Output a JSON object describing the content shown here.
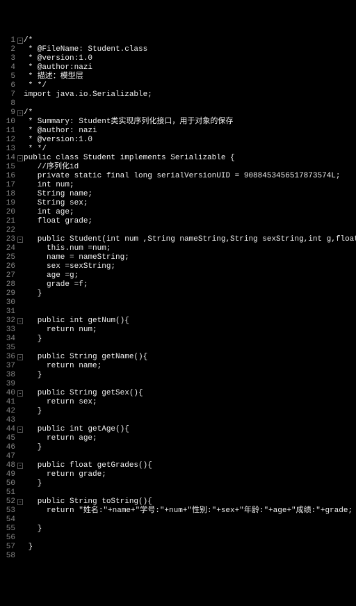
{
  "lines": [
    {
      "n": 1,
      "f": "⊟",
      "t": "/*"
    },
    {
      "n": 2,
      "f": "",
      "t": " * @FileName: Student.class"
    },
    {
      "n": 3,
      "f": "",
      "t": " * @version:1.0"
    },
    {
      "n": 4,
      "f": "",
      "t": " * @author:nazi"
    },
    {
      "n": 5,
      "f": "",
      "t": " * 描述：模型层"
    },
    {
      "n": 6,
      "f": "",
      "t": " * */"
    },
    {
      "n": 7,
      "f": "",
      "t": "import java.io.Serializable;"
    },
    {
      "n": 8,
      "f": "",
      "t": ""
    },
    {
      "n": 9,
      "f": "⊟",
      "t": "/*"
    },
    {
      "n": 10,
      "f": "",
      "t": " * Summary: Student类实现序列化接口，用于对象的保存"
    },
    {
      "n": 11,
      "f": "",
      "t": " * @author: nazi"
    },
    {
      "n": 12,
      "f": "",
      "t": " * @version:1.0"
    },
    {
      "n": 13,
      "f": "",
      "t": " * */"
    },
    {
      "n": 14,
      "f": "⊟",
      "t": "public class Student implements Serializable {"
    },
    {
      "n": 15,
      "f": "",
      "t": "   //序列化id"
    },
    {
      "n": 16,
      "f": "",
      "t": "   private static final long serialVersionUID = 9088453456517873574L;"
    },
    {
      "n": 17,
      "f": "",
      "t": "   int num;"
    },
    {
      "n": 18,
      "f": "",
      "t": "   String name;"
    },
    {
      "n": 19,
      "f": "",
      "t": "   String sex;"
    },
    {
      "n": 20,
      "f": "",
      "t": "   int age;"
    },
    {
      "n": 21,
      "f": "",
      "t": "   float grade;"
    },
    {
      "n": 22,
      "f": "",
      "t": ""
    },
    {
      "n": 23,
      "f": "⊟",
      "t": "   public Student(int num ,String nameString,String sexString,int g,float f){"
    },
    {
      "n": 24,
      "f": "",
      "t": "     this.num =num;"
    },
    {
      "n": 25,
      "f": "",
      "t": "     name = nameString;"
    },
    {
      "n": 26,
      "f": "",
      "t": "     sex =sexString;"
    },
    {
      "n": 27,
      "f": "",
      "t": "     age =g;"
    },
    {
      "n": 28,
      "f": "",
      "t": "     grade =f;"
    },
    {
      "n": 29,
      "f": "",
      "t": "   }"
    },
    {
      "n": 30,
      "f": "",
      "t": ""
    },
    {
      "n": 31,
      "f": "",
      "t": ""
    },
    {
      "n": 32,
      "f": "⊟",
      "t": "   public int getNum(){"
    },
    {
      "n": 33,
      "f": "",
      "t": "     return num;"
    },
    {
      "n": 34,
      "f": "",
      "t": "   }"
    },
    {
      "n": 35,
      "f": "",
      "t": ""
    },
    {
      "n": 36,
      "f": "⊟",
      "t": "   public String getName(){"
    },
    {
      "n": 37,
      "f": "",
      "t": "     return name;"
    },
    {
      "n": 38,
      "f": "",
      "t": "   }"
    },
    {
      "n": 39,
      "f": "",
      "t": ""
    },
    {
      "n": 40,
      "f": "⊟",
      "t": "   public String getSex(){"
    },
    {
      "n": 41,
      "f": "",
      "t": "     return sex;"
    },
    {
      "n": 42,
      "f": "",
      "t": "   }"
    },
    {
      "n": 43,
      "f": "",
      "t": ""
    },
    {
      "n": 44,
      "f": "⊟",
      "t": "   public int getAge(){"
    },
    {
      "n": 45,
      "f": "",
      "t": "     return age;"
    },
    {
      "n": 46,
      "f": "",
      "t": "   }"
    },
    {
      "n": 47,
      "f": "",
      "t": ""
    },
    {
      "n": 48,
      "f": "⊟",
      "t": "   public float getGrades(){"
    },
    {
      "n": 49,
      "f": "",
      "t": "     return grade;"
    },
    {
      "n": 50,
      "f": "",
      "t": "   }"
    },
    {
      "n": 51,
      "f": "",
      "t": ""
    },
    {
      "n": 52,
      "f": "⊟",
      "t": "   public String toString(){"
    },
    {
      "n": 53,
      "f": "",
      "t": "     return \"姓名:\"+name+\"学号:\"+num+\"性别:\"+sex+\"年龄:\"+age+\"成绩:\"+grade;"
    },
    {
      "n": 54,
      "f": "",
      "t": ""
    },
    {
      "n": 55,
      "f": "",
      "t": "   }"
    },
    {
      "n": 56,
      "f": "",
      "t": ""
    },
    {
      "n": 57,
      "f": "",
      "t": " }"
    },
    {
      "n": 58,
      "f": "",
      "t": ""
    }
  ]
}
